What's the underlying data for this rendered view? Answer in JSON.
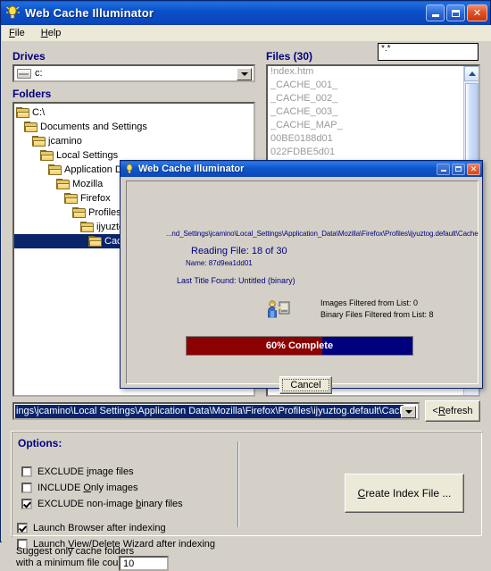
{
  "window": {
    "title": "Web Cache Illuminator",
    "icon": "lightbulb-icon",
    "minimize_label": "Minimize",
    "maximize_label": "Maximize",
    "close_label": "Close"
  },
  "menu": {
    "items": [
      {
        "label": "File",
        "accel": "F"
      },
      {
        "label": "Help",
        "accel": "H"
      }
    ]
  },
  "drives": {
    "label": "Drives",
    "selected": "c:",
    "icon": "hard-drive-icon"
  },
  "folders": {
    "label": "Folders",
    "items": [
      {
        "name": "C:\\",
        "depth": 0,
        "selected": false
      },
      {
        "name": "Documents and Settings",
        "depth": 1,
        "selected": false
      },
      {
        "name": "jcamino",
        "depth": 2,
        "selected": false
      },
      {
        "name": "Local Settings",
        "depth": 3,
        "selected": false
      },
      {
        "name": "Application Data",
        "depth": 4,
        "selected": false
      },
      {
        "name": "Mozilla",
        "depth": 5,
        "selected": false
      },
      {
        "name": "Firefox",
        "depth": 6,
        "selected": false
      },
      {
        "name": "Profiles",
        "depth": 7,
        "selected": false
      },
      {
        "name": "ijyuztog.default",
        "depth": 8,
        "selected": false
      },
      {
        "name": "Cache",
        "depth": 9,
        "selected": true
      }
    ]
  },
  "files": {
    "label": "Files (30)",
    "filter_value": "*.*",
    "items": [
      "!ndex.htm",
      "_CACHE_001_",
      "_CACHE_002_",
      "_CACHE_003_",
      "_CACHE_MAP_",
      "00BE0188d01",
      "022FDBE5d01"
    ]
  },
  "path_bar": {
    "value": "ings\\jcamino\\Local Settings\\Application Data\\Mozilla\\Firefox\\Profiles\\ijyuztog.default\\Cache",
    "refresh_label": "< Refresh",
    "refresh_accel": "R"
  },
  "options": {
    "label": "Options:",
    "checkboxes": [
      {
        "label_pre": "EXCLUDE ",
        "accel": "i",
        "label_post": "mage files",
        "checked": false
      },
      {
        "label_pre": "INCLUDE ",
        "accel": "O",
        "label_post": "nly images",
        "checked": false
      },
      {
        "label_pre": "EXCLUDE non-image ",
        "accel": "b",
        "label_post": "inary files",
        "checked": true
      },
      {
        "label_pre": "Launch Browser after indexing",
        "accel": "",
        "label_post": "",
        "checked": true
      },
      {
        "label_pre": "Launch ",
        "accel": "V",
        "label_post": "iew/Delete Wizard after indexing",
        "checked": false
      }
    ],
    "count_label_line1": "Suggest only cache folders",
    "count_label_line2": "with a minimum file count of",
    "count_value": "10",
    "create_button_pre": "C",
    "create_button_post": "reate Index File ..."
  },
  "dialog": {
    "title": "Web Cache Illuminator",
    "icon": "lightbulb-icon",
    "path": "...nd_Settings\\jcamino\\Local_Settings\\Application_Data\\Mozilla\\Firefox\\Profiles\\ijyuztog.default\\Cache",
    "reading_file": "Reading File: 18 of 30",
    "file_name": "Name: 87d9ea1dd01",
    "last_title_found": "Last Title Found:  Untitled (binary)",
    "images_filtered": "Images Filtered from List: 0",
    "binary_filtered": "Binary Files Filtered from List: 8",
    "progress_percent": 60,
    "progress_text": "60% Complete",
    "progress_fill_color": "#8b0000",
    "progress_track_color": "#00007e",
    "cancel_label": "Cancel"
  }
}
